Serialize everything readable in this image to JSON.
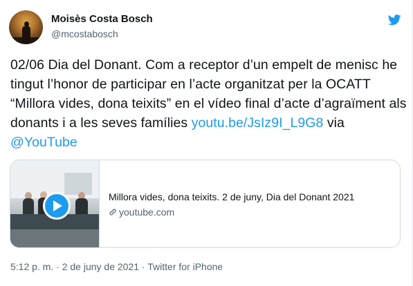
{
  "author": {
    "display_name": "Moisès Costa Bosch",
    "handle": "@mcostabosch"
  },
  "icons": {
    "brand": "twitter-bird-icon",
    "avatar": "profile-photo-silhouette",
    "play": "play-icon",
    "link": "link-icon"
  },
  "tweet": {
    "text_1": "02/06 Dia del Donant. Com a receptor d’un empelt de menisc he tingut l’honor de participar en l’acte organitzat per la OCATT “Millora vides, dona teixits” en el vídeo final d’acte d’agraïment als donants i a les seves famílies ",
    "link_text": "youtu.be/JsIz9I_L9G8",
    "text_2": " via ",
    "mention": "@YouTube"
  },
  "card": {
    "title": "Millora vides, dona teixits. 2 de juny, Dia del Donant 2021",
    "domain": "youtube.com"
  },
  "meta": {
    "time": "5:12 p. m.",
    "separator_1": " · ",
    "date": "2 de juny de 2021",
    "separator_2": " · ",
    "source": "Twitter for iPhone"
  },
  "colors": {
    "accent": "#1d9bf0",
    "text": "#0f1419",
    "secondary": "#536471",
    "border": "#cfd9de"
  }
}
